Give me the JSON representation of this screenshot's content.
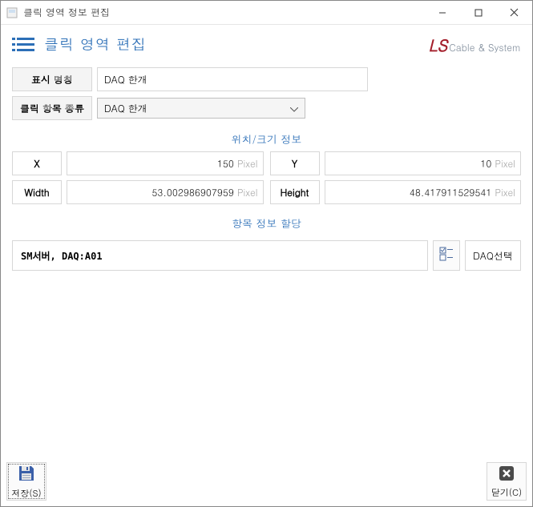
{
  "titlebar": {
    "text": "클릭 영역 정보 편집"
  },
  "header": {
    "title": "클릭 영역 편집",
    "brand_main": "LS",
    "brand_sub": "Cable & System"
  },
  "form": {
    "display_label": "표시 명칭",
    "display_value": "DAQ 한개",
    "type_label": "클릭 항목 종류",
    "type_value": "DAQ 한개"
  },
  "position": {
    "title": "위치/크기 정보",
    "x_label": "X",
    "x_value": "150",
    "x_unit": "Pixel",
    "y_label": "Y",
    "y_value": "10",
    "y_unit": "Pixel",
    "width_label": "Width",
    "width_value": "53.002986907959",
    "width_unit": "Pixel",
    "height_label": "Height",
    "height_value": "48.417911529541",
    "height_unit": "Pixel"
  },
  "assign": {
    "title": "항목 정보 할당",
    "text": "SM서버, DAQ:A01",
    "daq_select": "DAQ선택"
  },
  "footer": {
    "save": "저장(S)",
    "close": "닫기(C)"
  }
}
